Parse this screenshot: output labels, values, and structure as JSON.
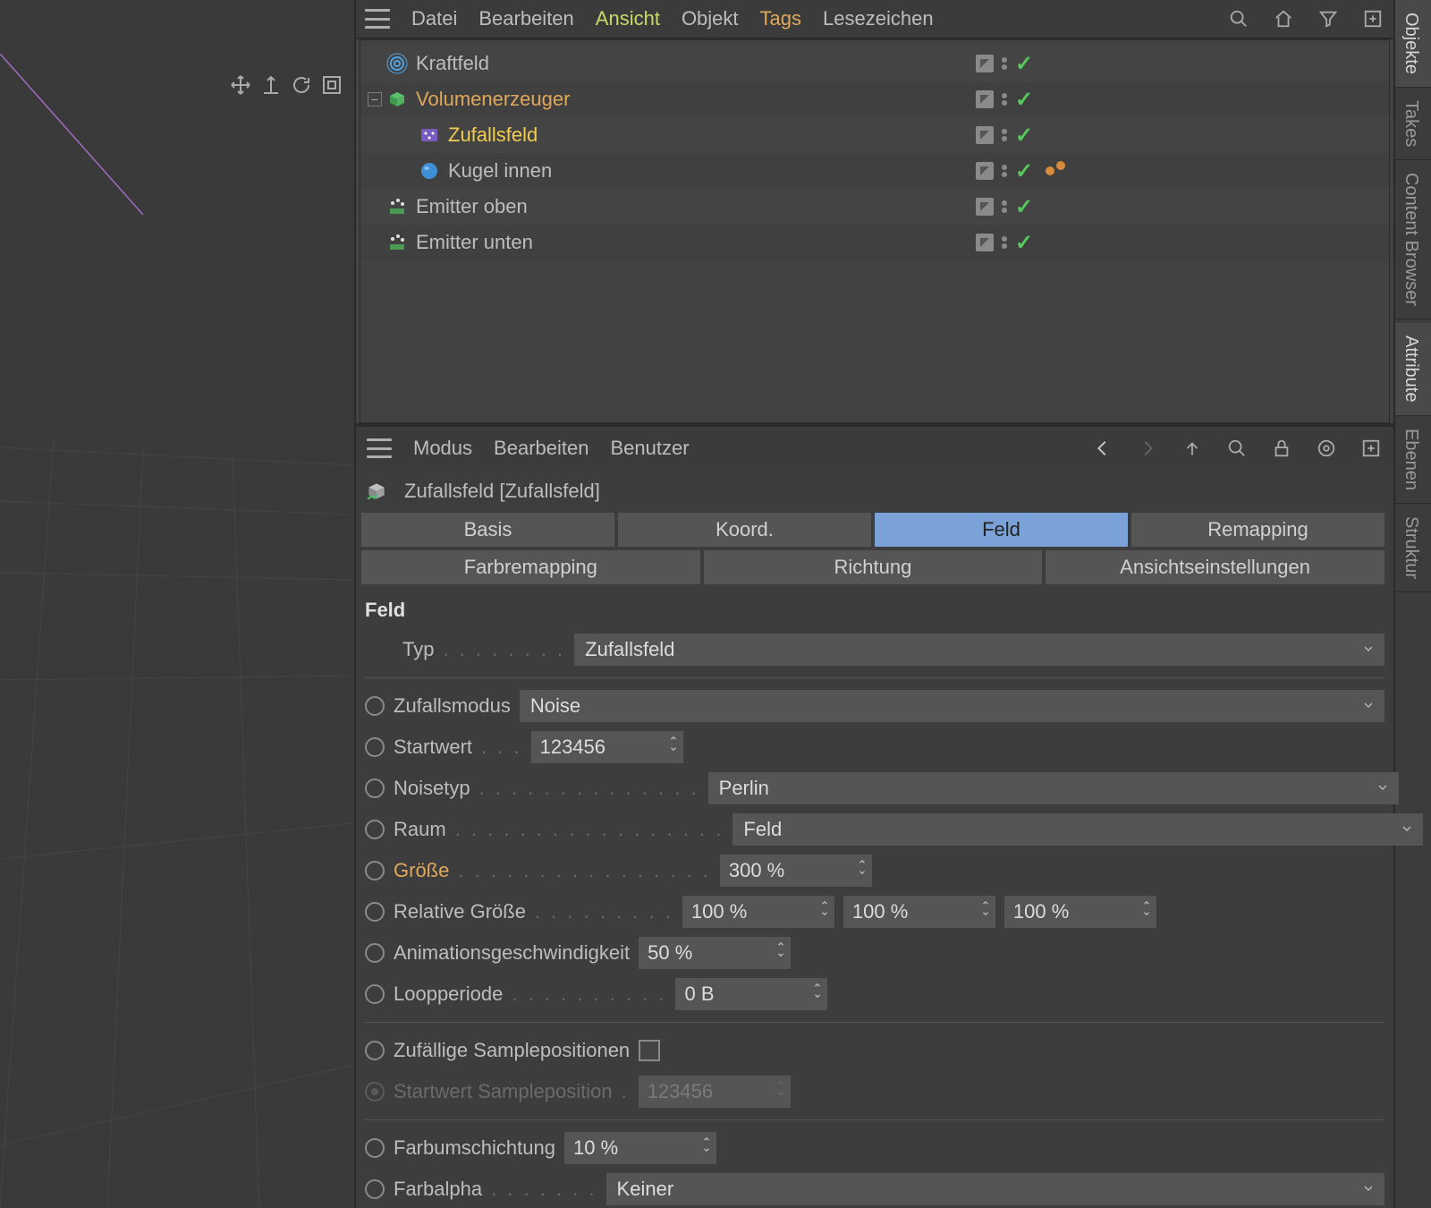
{
  "object_manager": {
    "menu": {
      "datei": "Datei",
      "bearbeiten": "Bearbeiten",
      "ansicht": "Ansicht",
      "objekt": "Objekt",
      "tags": "Tags",
      "lesezeichen": "Lesezeichen"
    },
    "tree": [
      {
        "name": "Kraftfeld",
        "indent": 1,
        "hasExpander": false,
        "style": "plain",
        "icon": "radial"
      },
      {
        "name": "Volumenerzeuger",
        "indent": 1,
        "hasExpander": true,
        "style": "orange",
        "icon": "cube-green"
      },
      {
        "name": "Zufallsfeld",
        "indent": 2,
        "hasExpander": false,
        "style": "yellow",
        "icon": "random"
      },
      {
        "name": "Kugel innen",
        "indent": 2,
        "hasExpander": false,
        "style": "plain",
        "icon": "sphere",
        "extraDots": true
      },
      {
        "name": "Emitter oben",
        "indent": 1,
        "hasExpander": false,
        "style": "plain",
        "icon": "emitter"
      },
      {
        "name": "Emitter unten",
        "indent": 1,
        "hasExpander": false,
        "style": "plain",
        "icon": "emitter"
      }
    ]
  },
  "side_tabs": {
    "objekte": "Objekte",
    "takes": "Takes",
    "content": "Content Browser",
    "attribute": "Attribute",
    "ebenen": "Ebenen",
    "struktur": "Struktur"
  },
  "attribute_manager": {
    "menu": {
      "modus": "Modus",
      "bearbeiten": "Bearbeiten",
      "benutzer": "Benutzer"
    },
    "title": "Zufallsfeld [Zufallsfeld]",
    "tabs": {
      "basis": "Basis",
      "koord": "Koord.",
      "feld": "Feld",
      "remapping": "Remapping",
      "farbremapping": "Farbremapping",
      "richtung": "Richtung",
      "ansicht": "Ansichtseinstellungen"
    },
    "section": "Feld",
    "params": {
      "typ_label": "Typ",
      "typ_value": "Zufallsfeld",
      "zufallsmodus_label": "Zufallsmodus",
      "zufallsmodus_value": "Noise",
      "startwert_label": "Startwert",
      "startwert_value": "123456",
      "noisetyp_label": "Noisetyp",
      "noisetyp_value": "Perlin",
      "raum_label": "Raum",
      "raum_value": "Feld",
      "groesse_label": "Größe",
      "groesse_value": "300 %",
      "relgroesse_label": "Relative Größe",
      "relgroesse_x": "100 %",
      "relgroesse_y": "100 %",
      "relgroesse_z": "100 %",
      "anim_label": "Animationsgeschwindigkeit",
      "anim_value": "50 %",
      "loop_label": "Loopperiode",
      "loop_value": "0 B",
      "zufpos_label": "Zufällige Samplepositionen",
      "startpos_label": "Startwert Sampleposition",
      "startpos_value": "123456",
      "farbum_label": "Farbumschichtung",
      "farbum_value": "10 %",
      "farbalpha_label": "Farbalpha",
      "farbalpha_value": "Keiner"
    }
  }
}
